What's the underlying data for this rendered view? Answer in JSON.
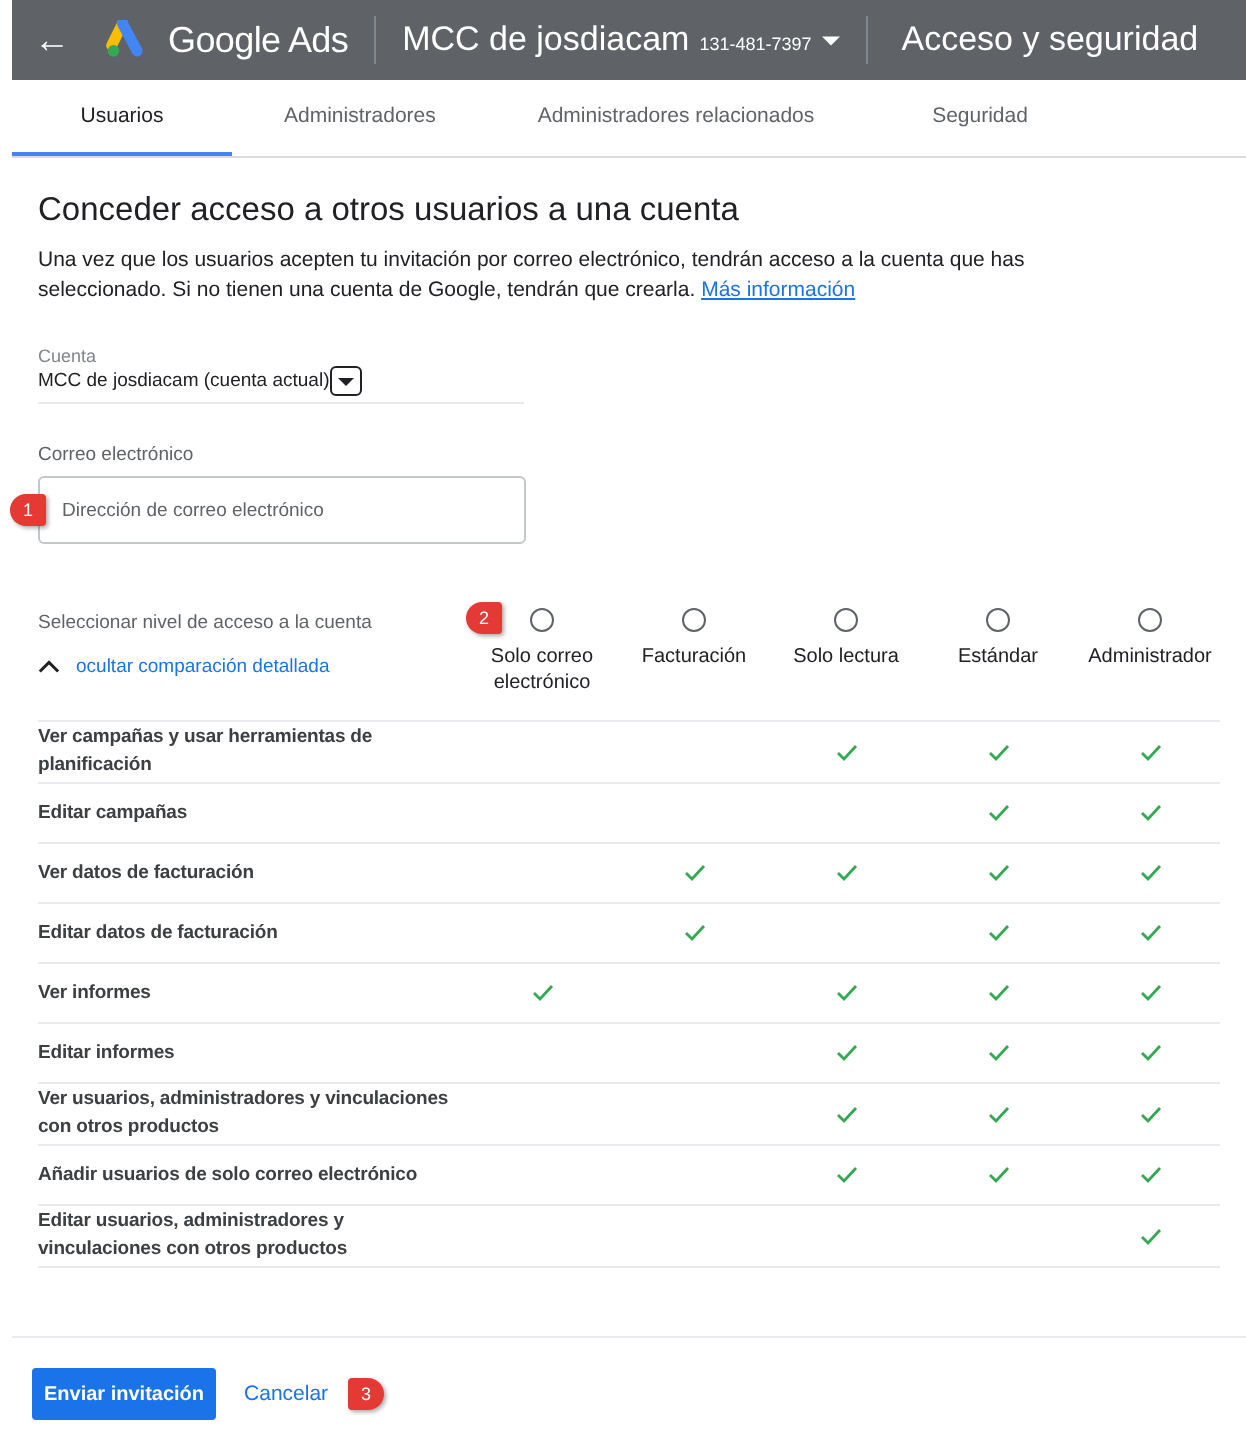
{
  "header": {
    "back": "←",
    "product": "Google Ads",
    "account": "MCC de josdiacam",
    "account_id": "131-481-7397",
    "page_title": "Acceso y seguridad"
  },
  "tabs": [
    {
      "label": "Usuarios",
      "selected": true
    },
    {
      "label": "Administradores",
      "selected": false
    },
    {
      "label": "Administradores relacionados",
      "selected": false
    },
    {
      "label": "Seguridad",
      "selected": false
    }
  ],
  "title": "Conceder acceso a otros usuarios a una cuenta",
  "description": "Una vez que los usuarios acepten tu invitación por correo electrónico, tendrán acceso a la cuenta que has seleccionado. Si no tienen una cuenta de Google, tendrán que crearla.",
  "description_link": "Más información",
  "account_field": {
    "label": "Cuenta",
    "value": "MCC de josdiacam (cuenta actual)"
  },
  "email_field": {
    "label": "Correo electrónico",
    "placeholder": "Dirección de correo electrónico",
    "callout": "1"
  },
  "access": {
    "label": "Seleccionar nivel de acceso a la cuenta",
    "toggle": "ocultar comparación detallada",
    "callout": "2",
    "levels": [
      {
        "label": "Solo correo electrónico",
        "selected": false
      },
      {
        "label": "Facturación",
        "selected": false
      },
      {
        "label": "Solo lectura",
        "selected": false
      },
      {
        "label": "Estándar",
        "selected": false
      },
      {
        "label": "Administrador",
        "selected": false
      }
    ]
  },
  "permissions": [
    {
      "label": "Ver campañas y usar herramientas de planificación",
      "checks": [
        false,
        false,
        true,
        true,
        true
      ]
    },
    {
      "label": "Editar campañas",
      "checks": [
        false,
        false,
        false,
        true,
        true
      ]
    },
    {
      "label": "Ver datos de facturación",
      "checks": [
        false,
        true,
        true,
        true,
        true
      ]
    },
    {
      "label": "Editar datos de facturación",
      "checks": [
        false,
        true,
        false,
        true,
        true
      ]
    },
    {
      "label": "Ver informes",
      "checks": [
        true,
        false,
        true,
        true,
        true
      ]
    },
    {
      "label": "Editar informes",
      "checks": [
        false,
        false,
        true,
        true,
        true
      ]
    },
    {
      "label": "Ver usuarios, administradores y vinculaciones con otros productos",
      "checks": [
        false,
        false,
        true,
        true,
        true
      ]
    },
    {
      "label": "Añadir usuarios de solo correo electrónico",
      "checks": [
        false,
        false,
        true,
        true,
        true
      ]
    },
    {
      "label": "Editar usuarios, administradores y vinculaciones con otros productos",
      "checks": [
        false,
        false,
        false,
        false,
        true
      ]
    }
  ],
  "buttons": {
    "primary": "Enviar invitación",
    "secondary": "Cancelar",
    "callout": "3"
  }
}
